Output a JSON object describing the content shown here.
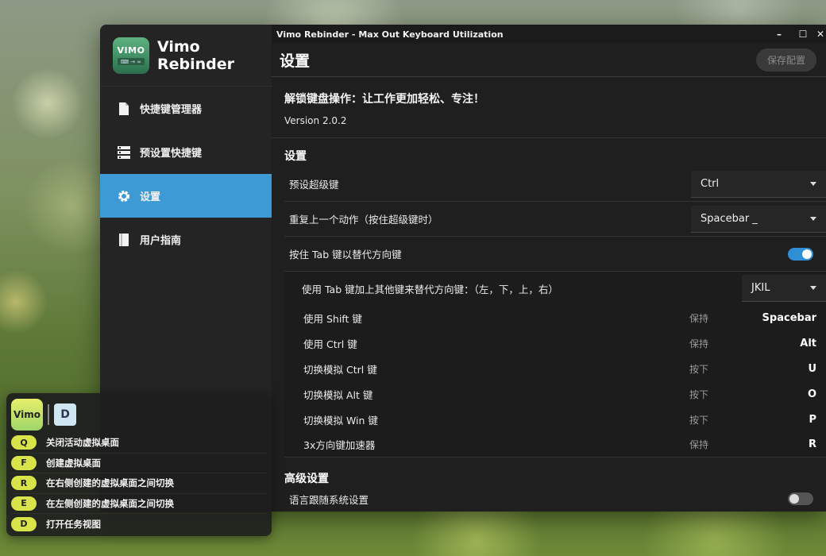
{
  "window": {
    "title": "Vimo Rebinder - Max Out Keyboard Utilization",
    "controls": {
      "minimize": "–",
      "maximize": "☐",
      "close": "✕"
    }
  },
  "brand": {
    "logo_word": "VIMO",
    "name_line1": "Vimo",
    "name_line2": "Rebinder"
  },
  "sidebar": {
    "items": [
      {
        "label": "快捷键管理器",
        "icon": "document-icon"
      },
      {
        "label": "预设置快捷键",
        "icon": "server-icon"
      },
      {
        "label": "设置",
        "icon": "gear-icon",
        "active": true
      },
      {
        "label": "用户指南",
        "icon": "book-icon"
      }
    ]
  },
  "header": {
    "title": "设置",
    "save_label": "保存配置"
  },
  "about": {
    "tagline": "解锁键盘操作：让工作更加轻松、专注！",
    "version": "Version 2.0.2"
  },
  "settings": {
    "section_title": "设置",
    "super_key": {
      "label": "预设超级键",
      "value": "Ctrl"
    },
    "repeat_action": {
      "label": "重复上一个动作（按住超级键时）",
      "value": "Spacebar _"
    },
    "tab_arrows": {
      "label": "按住 Tab 键以替代方向键",
      "enabled": true
    },
    "tab_combo": {
      "label": "使用 Tab 键加上其他键来替代方向键：（左，下，上，右）",
      "value": "JKIL"
    },
    "key_rows": [
      {
        "label": "使用 Shift 键",
        "mode": "保持",
        "key": "Spacebar"
      },
      {
        "label": "使用 Ctrl 键",
        "mode": "保持",
        "key": "Alt"
      },
      {
        "label": "切换模拟 Ctrl 键",
        "mode": "按下",
        "key": "U"
      },
      {
        "label": "切换模拟 Alt 键",
        "mode": "按下",
        "key": "O"
      },
      {
        "label": "切换模拟 Win 键",
        "mode": "按下",
        "key": "P"
      },
      {
        "label": "3x方向键加速器",
        "mode": "保持",
        "key": "R"
      }
    ]
  },
  "advanced": {
    "section_title": "高级设置",
    "language": {
      "label": "语言跟随系统设置",
      "enabled": false
    }
  },
  "hint_card": {
    "app_chip": "Vimo",
    "mode_chip": "D",
    "items": [
      {
        "key": "Q",
        "text": "关闭活动虚拟桌面"
      },
      {
        "key": "F",
        "text": "创建虚拟桌面"
      },
      {
        "key": "R",
        "text": "在右侧创建的虚拟桌面之间切换"
      },
      {
        "key": "E",
        "text": "在左侧创建的虚拟桌面之间切换"
      },
      {
        "key": "D",
        "text": "打开任务视图"
      }
    ]
  },
  "colors": {
    "accent": "#3d9ad5",
    "toggle_on": "#2f8fd6",
    "hint_key": "#d8e44a"
  }
}
